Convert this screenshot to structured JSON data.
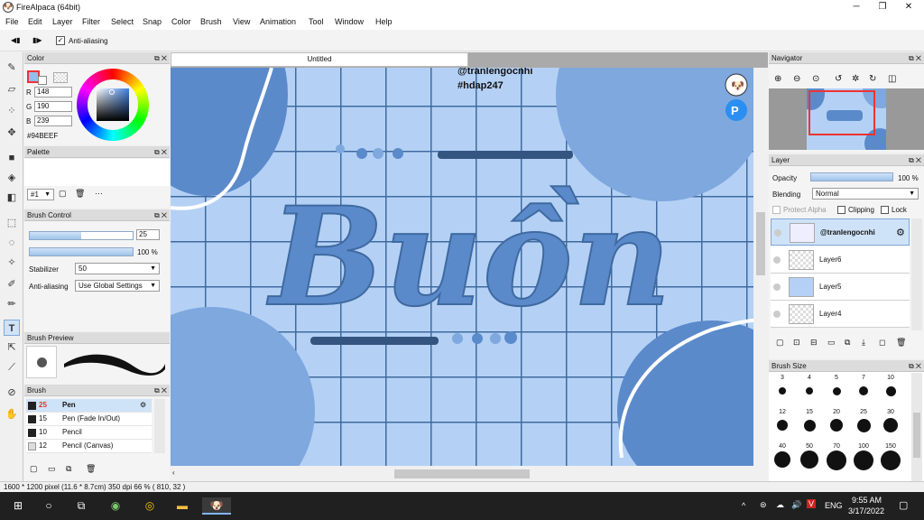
{
  "window": {
    "title": "FireAlpaca (64bit)",
    "minimize": "─",
    "maximize": "❐",
    "close": "✕"
  },
  "menu": [
    "File",
    "Edit",
    "Layer",
    "Filter",
    "Select",
    "Snap",
    "Color",
    "Brush",
    "View",
    "Animation",
    "Tool",
    "Window",
    "Help"
  ],
  "toolbar": {
    "prev": "◀▮",
    "next": "▮▶",
    "antialias_label": "Anti-aliasing",
    "antialias_checked": true
  },
  "color_panel": {
    "title": "Color",
    "r_label": "R",
    "r": "148",
    "g_label": "G",
    "g": "190",
    "b_label": "B",
    "b": "239",
    "hex": "#94BEEF",
    "primary_color": "#94BEEF"
  },
  "palette_panel": {
    "title": "Palette",
    "selector": "#1"
  },
  "brush_control": {
    "title": "Brush Control",
    "size": "25",
    "size_fill": 0.5,
    "opacity": "100 %",
    "opacity_fill": 1.0,
    "stabilizer_label": "Stabilizer",
    "stabilizer": "50",
    "antialias_label": "Anti-aliasing",
    "antialias": "Use Global Settings"
  },
  "brush_preview": {
    "title": "Brush Preview"
  },
  "brush_panel": {
    "title": "Brush",
    "items": [
      {
        "size": "25",
        "name": "Pen"
      },
      {
        "size": "15",
        "name": "Pen (Fade In/Out)"
      },
      {
        "size": "10",
        "name": "Pencil"
      },
      {
        "size": "12",
        "name": "Pencil (Canvas)"
      }
    ]
  },
  "document": {
    "tab": "Untitled",
    "watermark1": "@tranlengocnhi",
    "watermark2": "#hdap247",
    "lettering": "Buồn",
    "colors": {
      "bg": "#b4d1f5",
      "grid": "#3f6aa0",
      "accent": "#5b8acb",
      "light": "#7ea8de",
      "dark": "#34557f"
    }
  },
  "navigator": {
    "title": "Navigator"
  },
  "layer_panel": {
    "title": "Layer",
    "opacity_label": "Opacity",
    "opacity": "100 %",
    "opacity_fill": 1.0,
    "blending_label": "Blending",
    "blending": "Normal",
    "protect_alpha": "Protect Alpha",
    "clipping": "Clipping",
    "lock": "Lock",
    "layers": [
      {
        "name": "@tranlengocnhi",
        "selected": true
      },
      {
        "name": "Layer6"
      },
      {
        "name": "Layer5"
      },
      {
        "name": "Layer4"
      }
    ]
  },
  "brush_size": {
    "title": "Brush Size",
    "sizes": [
      "3",
      "4",
      "5",
      "7",
      "10",
      "12",
      "15",
      "20",
      "25",
      "30",
      "40",
      "50",
      "70",
      "100",
      "150"
    ]
  },
  "status": "1600 * 1200 pixel  (11.6 * 8.7cm)  350 dpi  66 %  ( 810, 32 )",
  "taskbar": {
    "time": "9:55 AM",
    "date": "3/17/2022",
    "lang": "ENG"
  }
}
